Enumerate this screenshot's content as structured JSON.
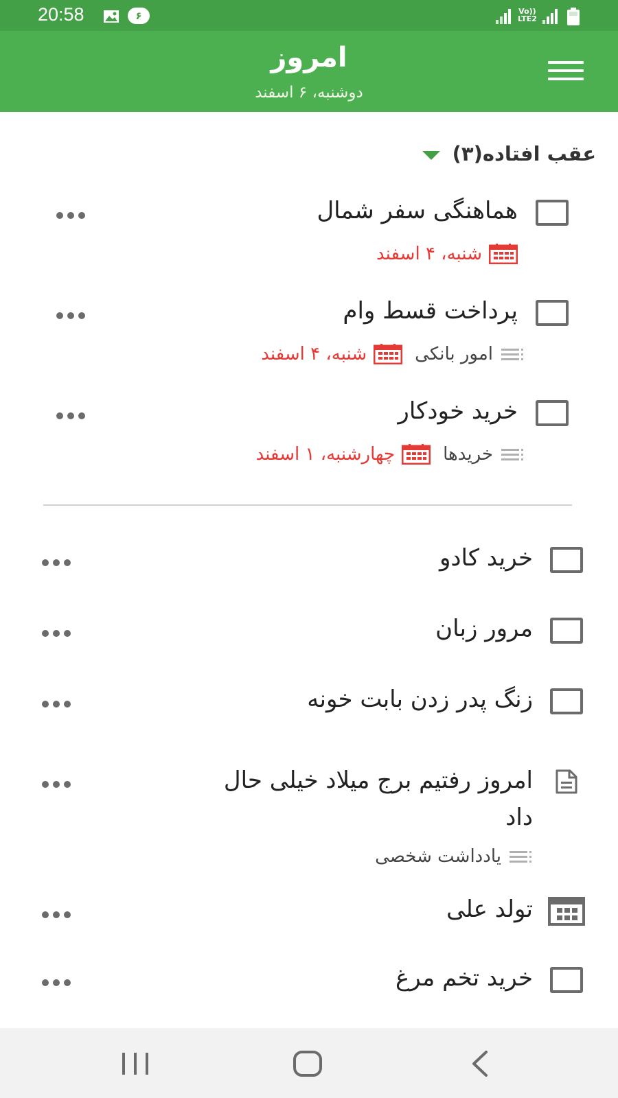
{
  "status_bar": {
    "time": "20:58",
    "notification_badge": "۶",
    "network_label_top": "Vo))",
    "network_label_bottom": "LTE2",
    "icons": [
      "image-icon",
      "notification-badge",
      "signal-icon",
      "signal-icon",
      "battery-icon"
    ]
  },
  "app_bar": {
    "title": "امروز",
    "subtitle": "دوشنبه، ۶ اسفند",
    "menu_icon": "hamburger-icon",
    "color": "#4caf50"
  },
  "overdue_section": {
    "label": "عقب افتاده(۳)",
    "expanded": true,
    "tasks": [
      {
        "title": "هماهنگی سفر شمال",
        "list": "",
        "due": "شنبه، ۴ اسفند",
        "checked": false
      },
      {
        "title": "پرداخت قسط وام",
        "list": "امور بانکی",
        "due": "شنبه، ۴ اسفند",
        "checked": false
      },
      {
        "title": "خرید خودکار",
        "list": "خریدها",
        "due": "چهارشنبه، ۱ اسفند",
        "checked": false
      }
    ]
  },
  "today_items": [
    {
      "type": "task",
      "title": "خرید کادو",
      "checked": false
    },
    {
      "type": "task",
      "title": "مرور زبان",
      "checked": false
    },
    {
      "type": "task",
      "title": "زنگ پدر زدن بابت خونه",
      "checked": false
    },
    {
      "type": "note",
      "title_line1": "امروز رفتیم برج میلاد خیلی حال",
      "title_line2": "داد",
      "list": "یادداشت شخصی"
    },
    {
      "type": "event",
      "title": "تولد علی"
    },
    {
      "type": "task",
      "title": "خرید تخم مرغ",
      "checked": false
    }
  ],
  "colors": {
    "accent": "#4caf50",
    "status_bar": "#43a047",
    "overdue": "#e53935",
    "icon_gray": "#6b6b6b"
  }
}
